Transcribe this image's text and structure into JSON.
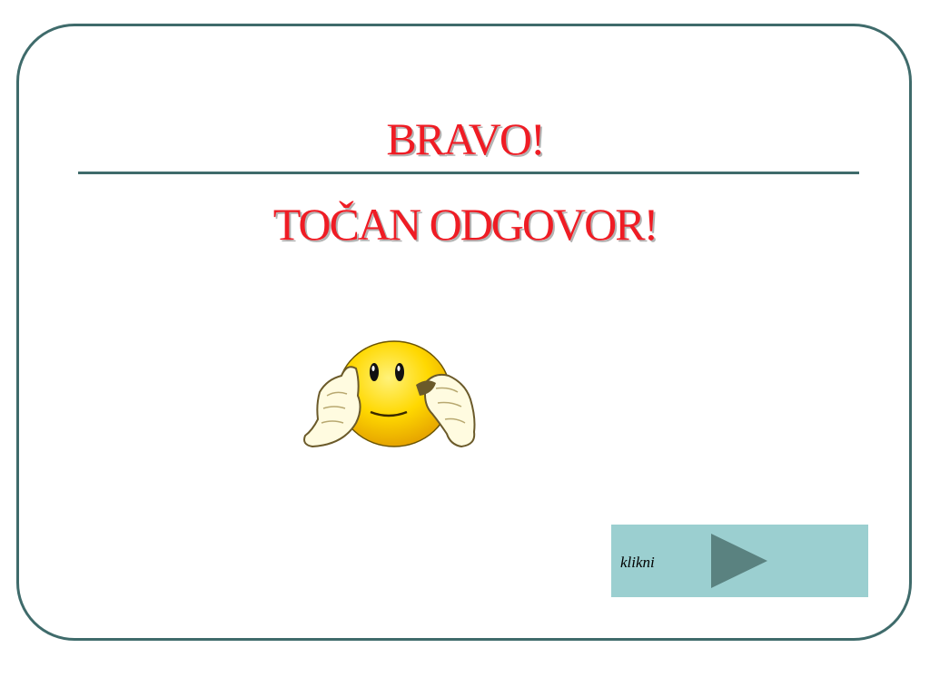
{
  "slide": {
    "title_line1": "BRAVO!",
    "title_line2": "TOČAN ODGOVOR!",
    "title_color": "#ef1c24",
    "rule_color": "#3f6b6b",
    "frame_color": "#3f6b6b"
  },
  "illustration": {
    "icon": "smiley-hands-on-face-icon"
  },
  "navigation": {
    "next_label": "klikni",
    "next_icon": "play-arrow-icon",
    "panel_color": "#9bcfd0",
    "arrow_color": "#5a8280"
  }
}
